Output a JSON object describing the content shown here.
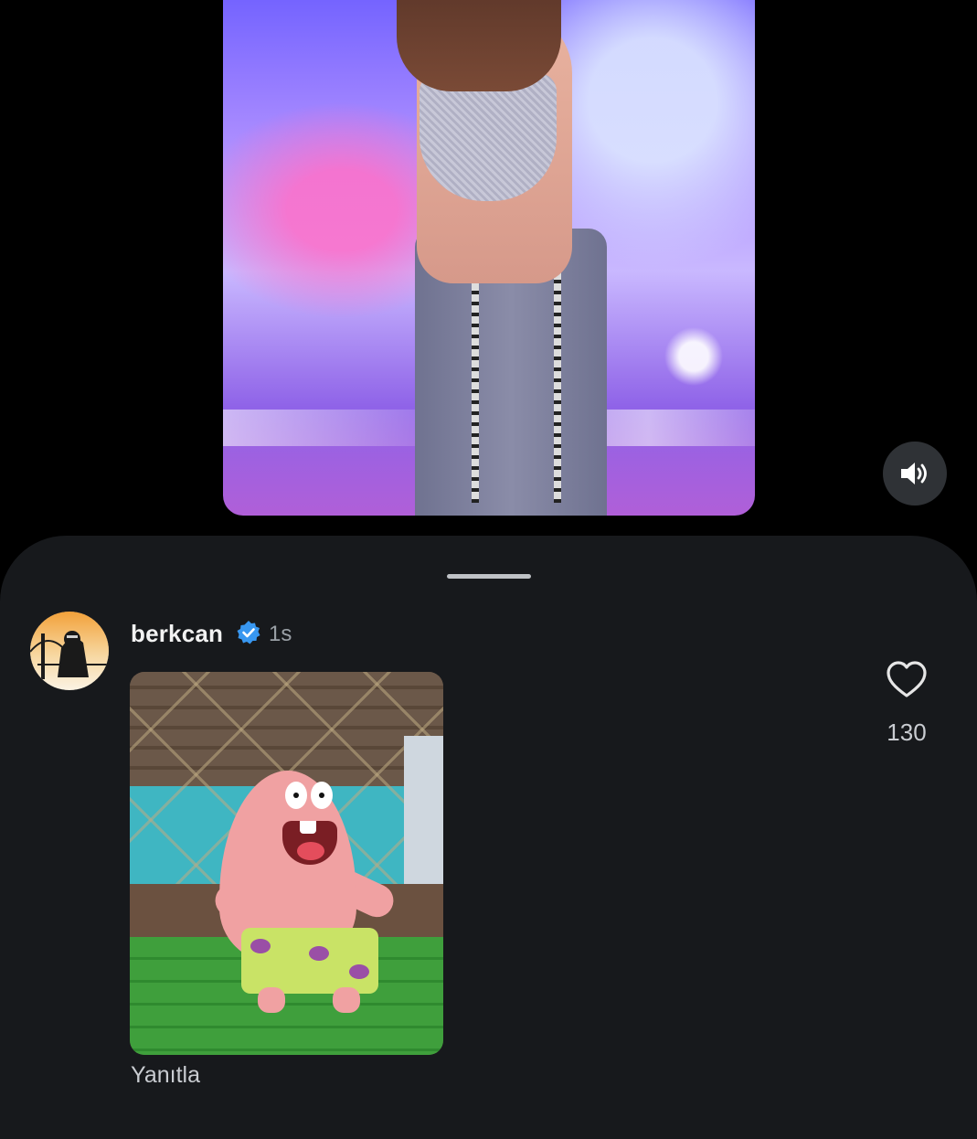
{
  "media": {
    "icon_sound": "speaker-on-icon"
  },
  "comment": {
    "username": "berkcan",
    "verified_icon": "verified-badge-icon",
    "timestamp": "1s",
    "reply_label": "Yanıtla",
    "like_icon": "heart-outline-icon",
    "like_count": "130"
  },
  "colors": {
    "sheet_background": "#17191c",
    "verified_blue": "#3897f0",
    "text_primary": "#f2f2f2",
    "text_secondary": "#9aa0a6"
  }
}
